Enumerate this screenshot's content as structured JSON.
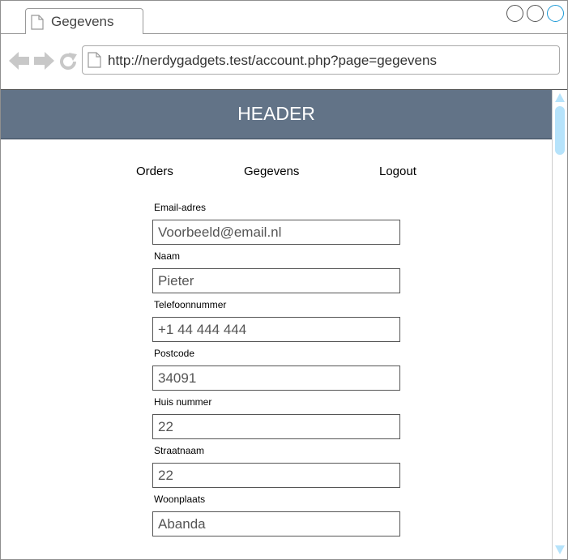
{
  "browser": {
    "tab_title": "Gegevens",
    "url": "http://nerdygadgets.test/account.php?page=gegevens",
    "icons": {
      "back": "back-arrow-icon",
      "forward": "forward-arrow-icon",
      "reload": "reload-icon",
      "page": "document-icon"
    }
  },
  "page": {
    "header": "HEADER",
    "menu": {
      "orders": "Orders",
      "gegevens": "Gegevens",
      "logout": "Logout"
    },
    "form": {
      "fields": [
        {
          "label": "Email-adres",
          "value": "Voorbeeld@email.nl"
        },
        {
          "label": "Naam",
          "value": "Pieter"
        },
        {
          "label": "Telefoonnummer",
          "value": "+1 44 444 444"
        },
        {
          "label": "Postcode",
          "value": "34091"
        },
        {
          "label": "Huis nummer",
          "value": "22"
        },
        {
          "label": "Straatnaam",
          "value": "22"
        },
        {
          "label": "Woonplaats",
          "value": "Abanda"
        }
      ]
    }
  },
  "colors": {
    "header_background": "#627387",
    "scroll_thumb": "#b6e3fb",
    "maximize_button_border": "#1e9ad6"
  }
}
